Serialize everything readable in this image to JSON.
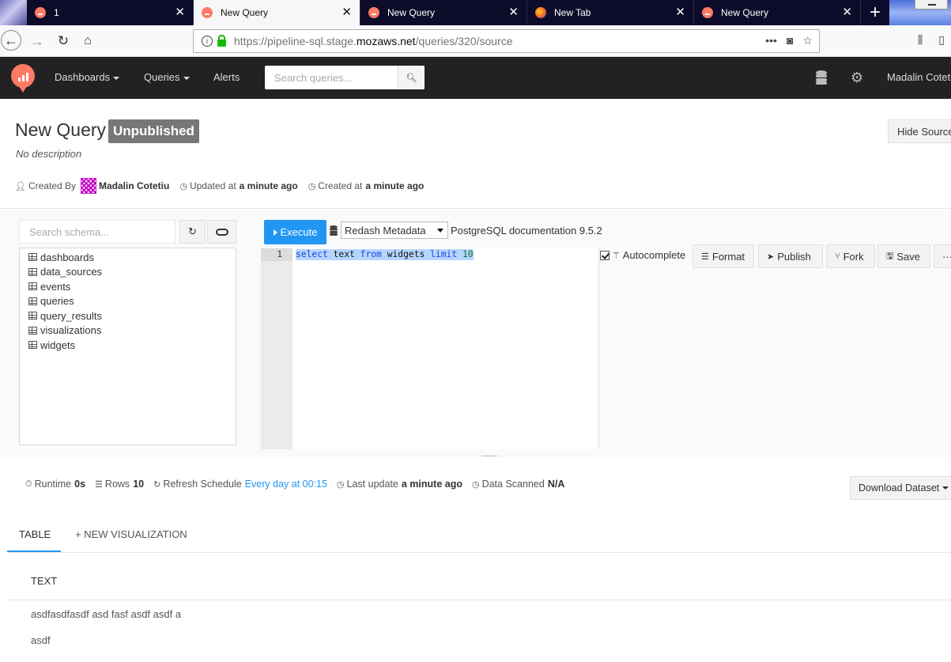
{
  "browser": {
    "tabs": [
      {
        "title": "1",
        "active": false
      },
      {
        "title": "New Query",
        "active": true
      },
      {
        "title": "New Query",
        "active": false
      },
      {
        "title": "New Tab",
        "active": false,
        "icon": "firefox-icon"
      },
      {
        "title": "New Query",
        "active": false
      }
    ],
    "url_prefix": "https://pipeline-sql.stage.",
    "url_domain": "mozaws.net",
    "url_path": "/queries/320/source"
  },
  "app": {
    "menu": {
      "dashboards": "Dashboards",
      "queries": "Queries",
      "alerts": "Alerts"
    },
    "search_placeholder": "Search queries...",
    "user": "Madalin Cotetiu",
    "accent": "#ff7964"
  },
  "query": {
    "title": "New Query",
    "badge": "Unpublished",
    "description": "No description",
    "hide_source_label": "Hide Source",
    "created_by_label": "Created By",
    "author": "Madalin Cotetiu",
    "updated_label": "Updated at",
    "updated_value": "a minute ago",
    "created_label": "Created at",
    "created_value": "a minute ago"
  },
  "schema": {
    "search_placeholder": "Search schema...",
    "tables": [
      "dashboards",
      "data_sources",
      "events",
      "queries",
      "query_results",
      "visualizations",
      "widgets"
    ]
  },
  "editor": {
    "execute_label": "Execute",
    "data_source": "Redash Metadata",
    "doc_link": "PostgreSQL documentation 9.5.2",
    "line_number": "1",
    "code": "select text from widgets limit 10",
    "autocomplete_label": "Autocomplete",
    "autocomplete_checked": true,
    "format_label": "Format",
    "publish_label": "Publish",
    "fork_label": "Fork",
    "save_label": "Save",
    "more_label": "···",
    "execute_color": "#2196f3"
  },
  "results": {
    "runtime_label": "Runtime",
    "runtime_value": "0s",
    "rows_label": "Rows",
    "rows_value": "10",
    "refresh_label": "Refresh Schedule",
    "refresh_value": "Every day at 00:15",
    "last_update_label": "Last update",
    "last_update_value": "a minute ago",
    "scanned_label": "Data Scanned",
    "scanned_value": "N/A",
    "download_label": "Download Dataset",
    "tab_table": "TABLE",
    "tab_new_vis": "+ NEW VISUALIZATION",
    "column_header": "TEXT",
    "rows": [
      "asdfasdfasdf asd fasf asdf asdf a",
      "asdf"
    ]
  }
}
